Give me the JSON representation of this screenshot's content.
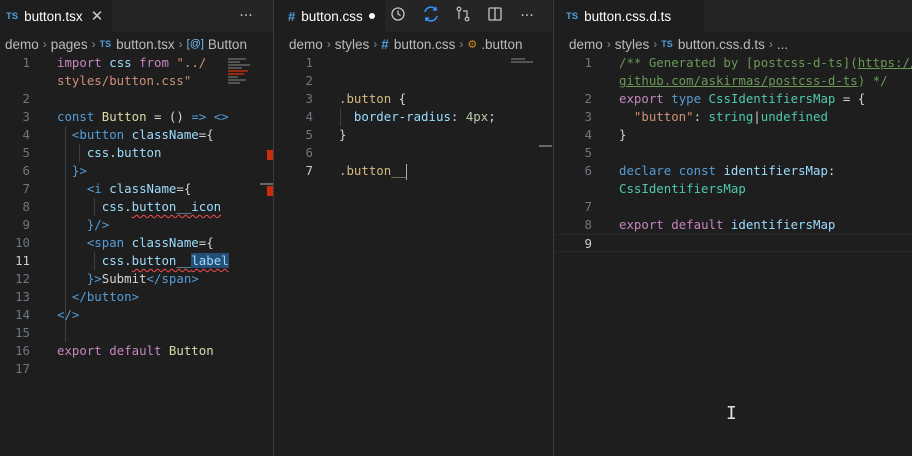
{
  "pane1": {
    "tab": {
      "icon": "TS",
      "label": "button.tsx"
    },
    "more_label": "···",
    "breadcrumb": [
      "demo",
      "pages",
      "button.tsx",
      "Button"
    ]
  },
  "pane2": {
    "tab": {
      "icon": "#",
      "label": "button.css"
    },
    "more_label": "···",
    "breadcrumb": [
      "demo",
      "styles",
      "button.css",
      ".button"
    ]
  },
  "pane3": {
    "tab": {
      "icon": "TS",
      "label": "button.css.d.ts"
    },
    "breadcrumb": [
      "demo",
      "styles",
      "button.css.d.ts",
      "..."
    ]
  },
  "code1_lines": [
    "import css from \"../\nstyles/button.css\"",
    "",
    "const Button = () => <>",
    "  <button className={",
    "    css.button",
    "  }>",
    "    <i className={",
    "      css.button__icon",
    "    }/>",
    "    <span className={",
    "      css.button__label",
    "    }>Submit</span>",
    "  </button>",
    "</>",
    "",
    "export default Button",
    ""
  ],
  "code2_lines": [
    "",
    "",
    ".button {",
    "  border-radius: 4px;",
    "}",
    "",
    ".button__"
  ],
  "code3_lines": [
    "/** Generated by [postcss-d-ts](https://\ngithub.com/askirmas/postcss-d-ts) */",
    "export type CssIdentifiersMap = {",
    "  \"button\": string|undefined",
    "}",
    "",
    "declare const identifiersMap:\nCssIdentifiersMap",
    "",
    "export default identifiersMap",
    ""
  ],
  "colors": {
    "background": "#1e1e1e",
    "tab_bar": "#252526",
    "ts_icon": "#4f9fde",
    "keyword": "#c586c0",
    "storage": "#569cd6",
    "string": "#ce9178",
    "variable": "#9cdcfe",
    "comment": "#6a9955",
    "error": "#f14c4c"
  }
}
